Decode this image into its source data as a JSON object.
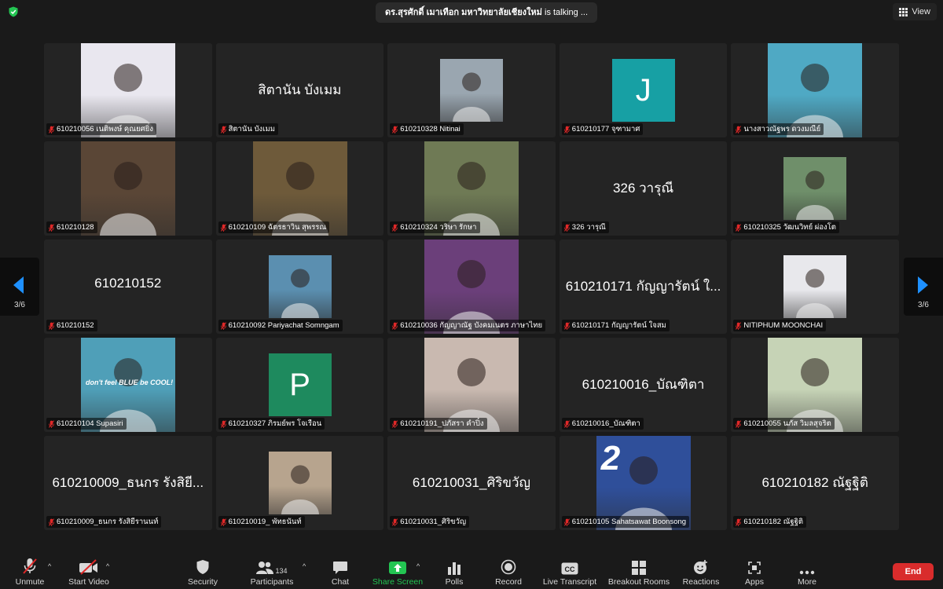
{
  "topbar": {
    "speaker": "ดร.สุรศักดิ์ เมาเทือก มหาวิทยาลัยเชียงใหม่",
    "talking_suffix": "is talking ...",
    "view_label": "View"
  },
  "pagination": {
    "left": "3/6",
    "right": "3/6"
  },
  "tiles": [
    {
      "label": "610210056 เนติพงษ์ คุณยศยิ่ง",
      "kind": "photo",
      "bg": "#e9e7ef"
    },
    {
      "label": "สิตานัน บังเมม",
      "kind": "name",
      "big": "สิตานัน บังเมม"
    },
    {
      "label": "610210328 Nitinai",
      "kind": "small",
      "bg": "#9aa6b0"
    },
    {
      "label": "610210177 จุฑามาศ",
      "kind": "avatar",
      "letter": "J",
      "bg": "#17a0a4"
    },
    {
      "label": "นางสาวณัฐพร ดวงมณีย์",
      "kind": "photo",
      "bg": "#4fa9c4"
    },
    {
      "label": "610210128",
      "kind": "photo",
      "bg": "#5a4636"
    },
    {
      "label": "610210109 ฉัตรธาวิน สุพรรณ",
      "kind": "photo",
      "bg": "#6e5a3a"
    },
    {
      "label": "610210324 วริษา รักษา",
      "kind": "photo",
      "bg": "#6f7a55"
    },
    {
      "label": "326 วารุณี",
      "kind": "name",
      "big": "326 วารุณี"
    },
    {
      "label": "610210325 วัฒนวิทย์ ผ่องโต",
      "kind": "small",
      "bg": "#6f8f6a"
    },
    {
      "label": "610210152",
      "kind": "name",
      "big": "610210152"
    },
    {
      "label": "610210092 Pariyachat Somngam",
      "kind": "small",
      "bg": "#5b8fb0"
    },
    {
      "label": "610210036 กัญญาณัฐ บังคมเนตร ภาษาไทย",
      "kind": "photo",
      "bg": "#6b3f7a"
    },
    {
      "label": "610210171 กัญญารัตน์ ใจสม",
      "kind": "name",
      "big": "610210171 กัญญารัตน์ ใ..."
    },
    {
      "label": "NITIPHUM MOONCHAI",
      "kind": "small",
      "bg": "#e8e8ec"
    },
    {
      "label": "610210104 Supasiri",
      "kind": "photo",
      "bg": "#4f9fb8",
      "overlay": "don't feel BLUE be COOL!"
    },
    {
      "label": "610210327 ภิรมย์พร โจเรือน",
      "kind": "avatar",
      "letter": "P",
      "bg": "#1e8a5e"
    },
    {
      "label": "610210191_ปภัสรา คำปิ๋ง",
      "kind": "photo",
      "bg": "#c9b9b0"
    },
    {
      "label": "610210016_บัณฑิตา",
      "kind": "name",
      "big": "610210016_บัณฑิตา"
    },
    {
      "label": "610210055 นภัส วิมลสุจริต",
      "kind": "photo",
      "bg": "#c6d3b6"
    },
    {
      "label": "610210009_ธนกร รังสิยีรานนท์",
      "kind": "name",
      "big": "610210009_ธนกร รังสิยี..."
    },
    {
      "label": "610210019_ พัทธนันท์",
      "kind": "small",
      "bg": "#b7a48e"
    },
    {
      "label": "610210031_ศิริขวัญ",
      "kind": "name",
      "big": "610210031_ศิริขวัญ"
    },
    {
      "label": "610210105 Sahatsawat Boonsong",
      "kind": "photo",
      "bg": "#2f4f9a",
      "overlay": "2"
    },
    {
      "label": "610210182 ณัฐฐิติ",
      "kind": "name",
      "big": "610210182 ณัฐฐิติ"
    }
  ],
  "toolbar": {
    "unmute": "Unmute",
    "start_video": "Start Video",
    "security": "Security",
    "participants": "Participants",
    "participants_count": "134",
    "chat": "Chat",
    "share_screen": "Share Screen",
    "polls": "Polls",
    "record": "Record",
    "live_transcript": "Live Transcript",
    "breakout_rooms": "Breakout Rooms",
    "reactions": "Reactions",
    "apps": "Apps",
    "more": "More",
    "end": "End"
  },
  "colors": {
    "end": "#d92c2c",
    "share": "#23c552",
    "muted": "#e02828",
    "shield": "#23c552"
  },
  "icons": [
    "shield-icon",
    "grid-view-icon",
    "microphone-muted-icon",
    "video-off-icon",
    "security-shield-icon",
    "participants-icon",
    "chat-bubble-icon",
    "share-screen-icon",
    "polls-icon",
    "record-icon",
    "cc-icon",
    "breakout-rooms-icon",
    "reactions-icon",
    "apps-icon",
    "more-icon",
    "arrow-left-icon",
    "arrow-right-icon"
  ]
}
